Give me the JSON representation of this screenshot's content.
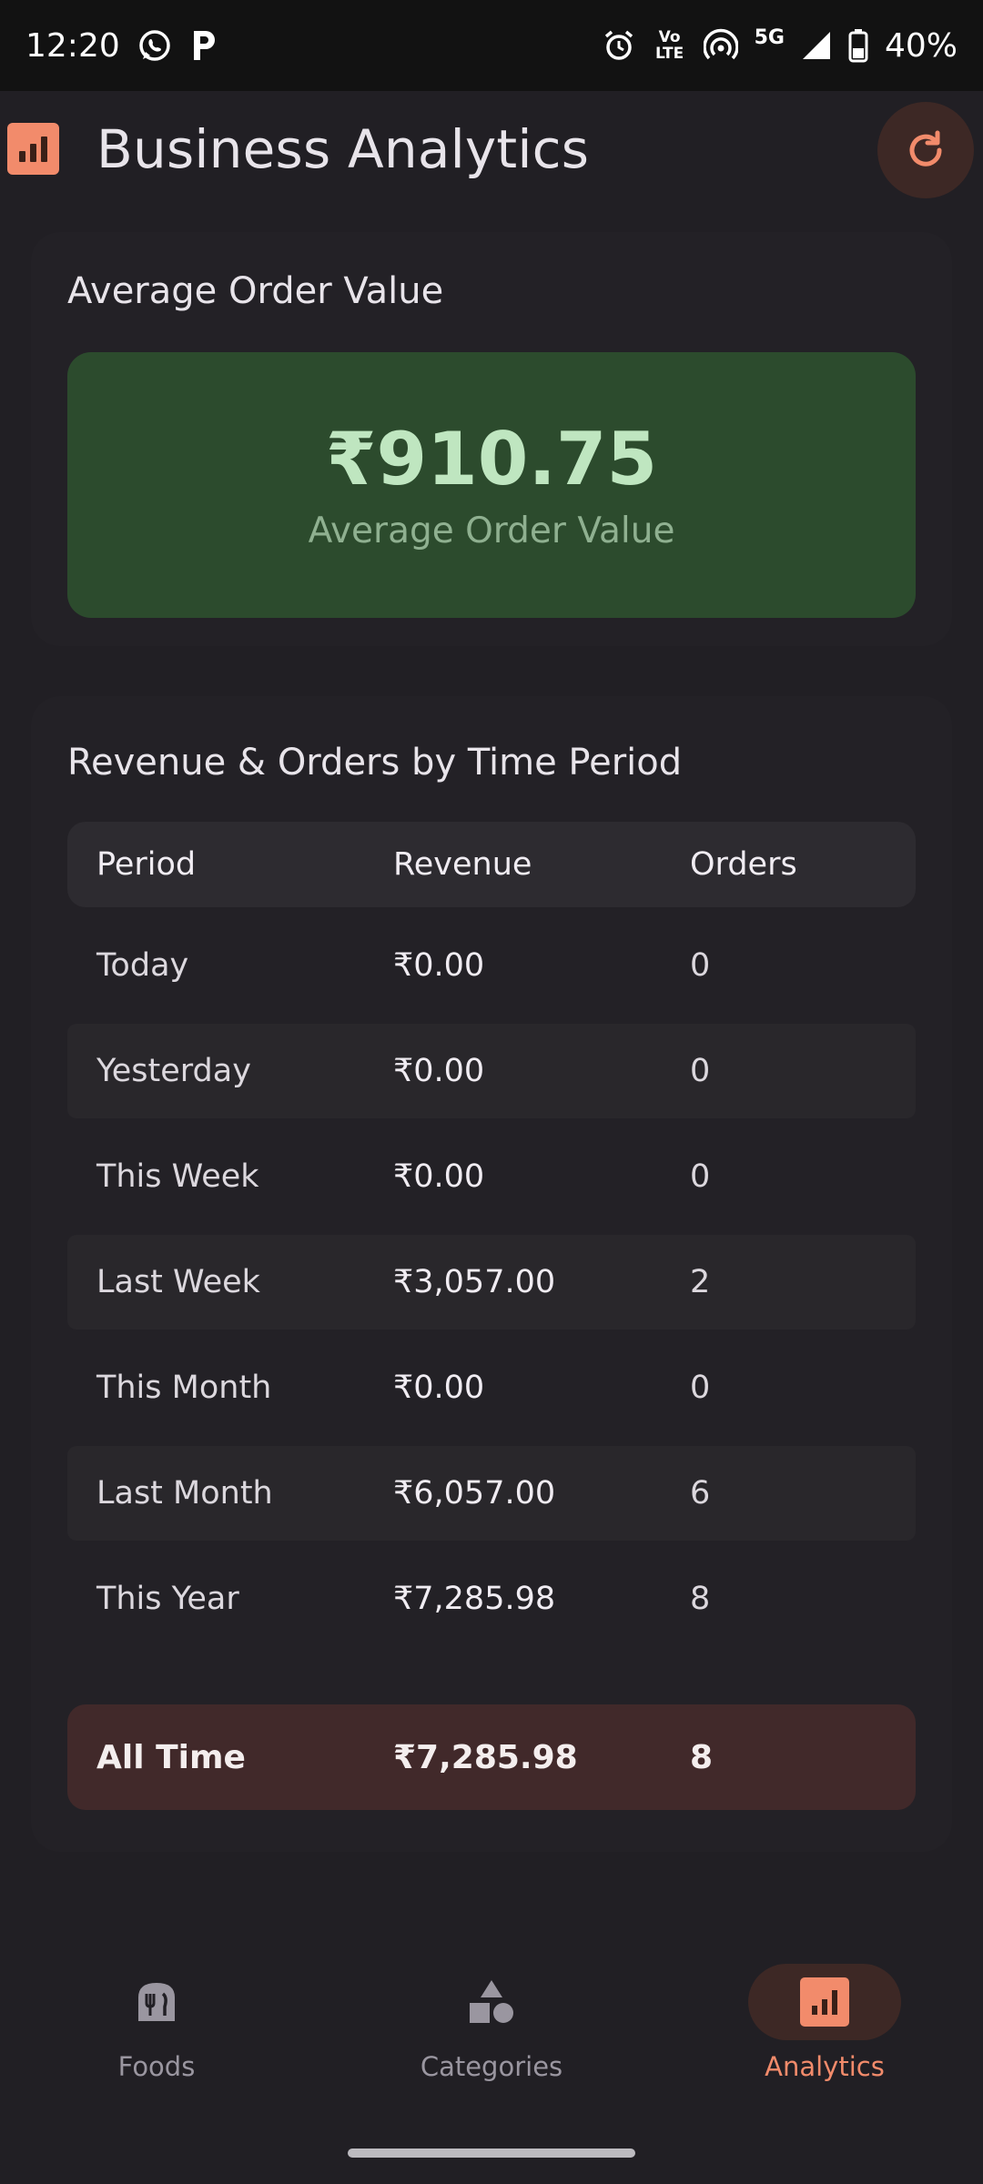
{
  "status_bar": {
    "time": "12:20",
    "network": "5G",
    "volte": "Vo LTE",
    "battery": "40%",
    "icons": [
      "whatsapp-icon",
      "p-app-icon",
      "alarm-icon",
      "volte-icon",
      "hotspot-icon",
      "signal-icon",
      "battery-icon"
    ]
  },
  "header": {
    "title": "Business Analytics",
    "refresh_icon": "refresh-icon"
  },
  "aov_card": {
    "title": "Average Order Value",
    "value": "₹910.75",
    "label": "Average Order Value"
  },
  "revenue_card": {
    "title": "Revenue & Orders by Time Period",
    "columns": {
      "period": "Period",
      "revenue": "Revenue",
      "orders": "Orders"
    },
    "rows": [
      {
        "period": "Today",
        "revenue": "₹0.00",
        "orders": "0"
      },
      {
        "period": "Yesterday",
        "revenue": "₹0.00",
        "orders": "0"
      },
      {
        "period": "This Week",
        "revenue": "₹0.00",
        "orders": "0"
      },
      {
        "period": "Last Week",
        "revenue": "₹3,057.00",
        "orders": "2"
      },
      {
        "period": "This Month",
        "revenue": "₹0.00",
        "orders": "0"
      },
      {
        "period": "Last Month",
        "revenue": "₹6,057.00",
        "orders": "6"
      },
      {
        "period": "This Year",
        "revenue": "₹7,285.98",
        "orders": "8"
      }
    ],
    "total": {
      "period": "All Time",
      "revenue": "₹7,285.98",
      "orders": "8"
    }
  },
  "bottom_nav": {
    "items": [
      {
        "label": "Foods",
        "icon": "restaurant-icon",
        "active": false
      },
      {
        "label": "Categories",
        "icon": "shapes-icon",
        "active": false
      },
      {
        "label": "Analytics",
        "icon": "analytics-icon",
        "active": true
      }
    ]
  },
  "colors": {
    "background": "#211f24",
    "accent": "#f28b6b",
    "aov_bg": "#2c4b2d",
    "aov_text": "#bfe6c0",
    "total_row_bg": "#41292a"
  }
}
